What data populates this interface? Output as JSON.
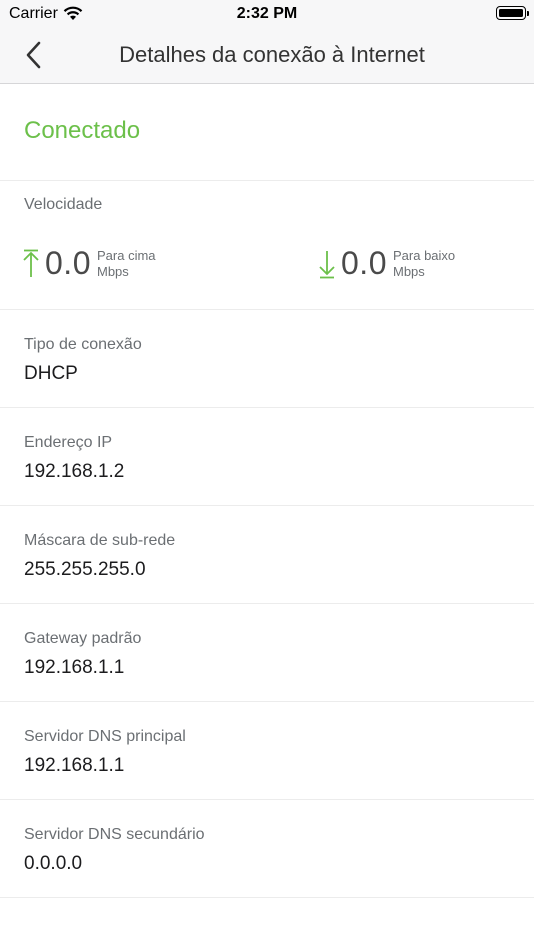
{
  "status_bar": {
    "carrier": "Carrier",
    "time": "2:32 PM"
  },
  "nav": {
    "title": "Detalhes da conexão à Internet"
  },
  "connection": {
    "status": "Conectado",
    "status_color": "#6cc04a"
  },
  "speed": {
    "label": "Velocidade",
    "upload": {
      "value": "0.0",
      "direction": "Para cima",
      "unit": "Mbps"
    },
    "download": {
      "value": "0.0",
      "direction": "Para baixo",
      "unit": "Mbps"
    }
  },
  "details": [
    {
      "label": "Tipo de conexão",
      "value": "DHCP"
    },
    {
      "label": "Endereço IP",
      "value": "192.168.1.2"
    },
    {
      "label": "Máscara de sub-rede",
      "value": "255.255.255.0"
    },
    {
      "label": "Gateway padrão",
      "value": "192.168.1.1"
    },
    {
      "label": "Servidor DNS principal",
      "value": "192.168.1.1"
    },
    {
      "label": "Servidor DNS secundário",
      "value": "0.0.0.0"
    }
  ]
}
